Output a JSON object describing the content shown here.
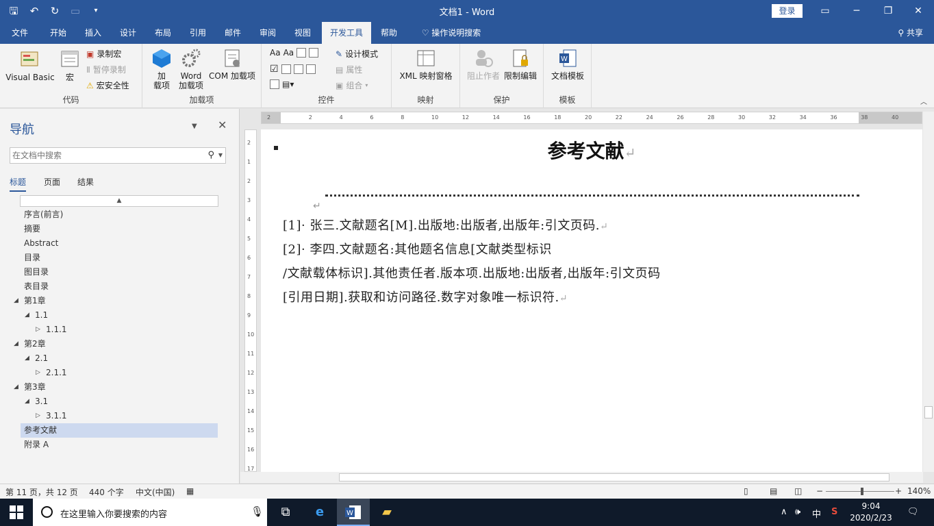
{
  "titlebar": {
    "title": "文档1  -  Word",
    "login": "登录",
    "minimize": "─",
    "restore": "❐",
    "close": "✕",
    "ribbon_display": "▭"
  },
  "tabs": [
    {
      "label": "文件"
    },
    {
      "label": "开始"
    },
    {
      "label": "插入"
    },
    {
      "label": "设计"
    },
    {
      "label": "布局"
    },
    {
      "label": "引用"
    },
    {
      "label": "邮件"
    },
    {
      "label": "审阅"
    },
    {
      "label": "视图"
    },
    {
      "label": "开发工具"
    },
    {
      "label": "帮助"
    },
    {
      "label": "操作说明搜索"
    }
  ],
  "share": "共享",
  "ribbon": {
    "code": {
      "label": "代码",
      "visual_basic": "Visual Basic",
      "macro": "宏",
      "record_macro": "录制宏",
      "pause_record": "暂停录制",
      "macro_security": "宏安全性"
    },
    "addins": {
      "label": "加载项",
      "addin_line1": "加",
      "addin_line2": "载项",
      "word_line1": "Word",
      "word_line2": "加载项",
      "com": "COM 加载项"
    },
    "controls": {
      "label": "控件",
      "design_mode": "设计模式",
      "properties": "属性",
      "group": "组合"
    },
    "mapping": {
      "label": "映射",
      "xml_pane": "XML 映射窗格"
    },
    "protect": {
      "label": "保护",
      "block_authors": "阻止作者",
      "restrict_editing": "限制编辑"
    },
    "templates": {
      "label": "模板",
      "doc_template": "文档模板"
    }
  },
  "nav": {
    "title": "导航",
    "search_placeholder": "在文档中搜索",
    "tabs": {
      "headings": "标题",
      "pages": "页面",
      "results": "结果"
    },
    "items": [
      {
        "label": "序言(前言)"
      },
      {
        "label": "摘要"
      },
      {
        "label": "Abstract"
      },
      {
        "label": "目录"
      },
      {
        "label": "图目录"
      },
      {
        "label": "表目录"
      },
      {
        "label": "第1章"
      },
      {
        "label": "1.1"
      },
      {
        "label": "1.1.1"
      },
      {
        "label": "第2章"
      },
      {
        "label": "2.1"
      },
      {
        "label": "2.1.1"
      },
      {
        "label": "第3章"
      },
      {
        "label": "3.1"
      },
      {
        "label": "3.1.1"
      },
      {
        "label": "参考文献"
      },
      {
        "label": "附录 A"
      }
    ]
  },
  "ruler": {
    "h_ticks": [
      "2",
      "2",
      "4",
      "6",
      "8",
      "10",
      "12",
      "14",
      "16",
      "18",
      "20",
      "22",
      "24",
      "26",
      "28",
      "30",
      "32",
      "34",
      "36",
      "38",
      "40"
    ],
    "v_ticks": [
      "2",
      "1",
      "2",
      "3",
      "4",
      "5",
      "6",
      "7",
      "8",
      "9",
      "10",
      "11",
      "12",
      "13",
      "14",
      "15",
      "16",
      "17"
    ]
  },
  "document": {
    "heading": "参考文献",
    "refs": [
      "[1]· 张三.文献题名[M].出版地:出版者,出版年:引文页码.",
      "[2]· 李四.文献题名:其他题名信息[文献类型标识",
      "/文献载体标识].其他责任者.版本项.出版地:出版者,出版年:引文页码",
      "[引用日期].获取和访问路径.数字对象唯一标识符."
    ],
    "para_mark": "↵"
  },
  "status": {
    "page": "第 11 页，共 12 页",
    "words": "440 个字",
    "language": "中文(中国)",
    "zoom": "140%"
  },
  "taskbar": {
    "search_placeholder": "在这里输入你要搜索的内容",
    "ime": "中",
    "time": "9:04",
    "date": "2020/2/23"
  }
}
